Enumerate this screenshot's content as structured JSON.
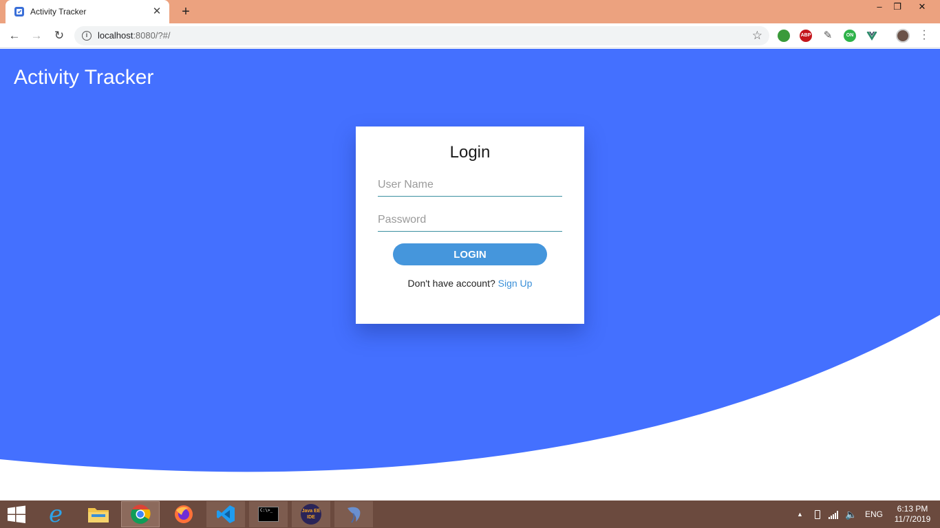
{
  "browser": {
    "tab_title": "Activity Tracker",
    "new_tab_label": "+",
    "url_host": "localhost",
    "url_rest": ":8080/?#/",
    "window_controls": {
      "minimize": "–",
      "restore": "❐",
      "close": "✕"
    },
    "extensions": [
      {
        "name": "globe-extension-icon",
        "label": "",
        "color": "#3a9a3a"
      },
      {
        "name": "adblock-extension-icon",
        "label": "ABP",
        "color": "#c4161c"
      },
      {
        "name": "eyedropper-extension-icon",
        "label": "",
        "color": "#555555"
      },
      {
        "name": "on-extension-icon",
        "label": "ON",
        "color": "#2fb34a"
      },
      {
        "name": "vue-devtools-extension-icon",
        "label": "",
        "color": "#2e8b6b"
      }
    ]
  },
  "page": {
    "app_title": "Activity Tracker",
    "accent_color": "#4470ff",
    "login": {
      "title": "Login",
      "username_placeholder": "User Name",
      "password_placeholder": "Password",
      "button_label": "LOGIN",
      "signup_prompt": "Don't have account? ",
      "signup_link": "Sign Up"
    }
  },
  "taskbar": {
    "apps": [
      {
        "name": "internet-explorer-icon",
        "glyph": "e"
      },
      {
        "name": "file-explorer-icon",
        "glyph": ""
      },
      {
        "name": "chrome-icon",
        "glyph": ""
      },
      {
        "name": "firefox-icon",
        "glyph": ""
      },
      {
        "name": "vscode-icon",
        "glyph": ""
      },
      {
        "name": "command-prompt-icon",
        "glyph": "C:\\>_"
      },
      {
        "name": "java-ee-ide-icon",
        "glyph": "Java EE IDE"
      },
      {
        "name": "mysql-workbench-icon",
        "glyph": ""
      }
    ],
    "language": "ENG",
    "time": "6:13 PM",
    "date": "11/7/2019"
  }
}
